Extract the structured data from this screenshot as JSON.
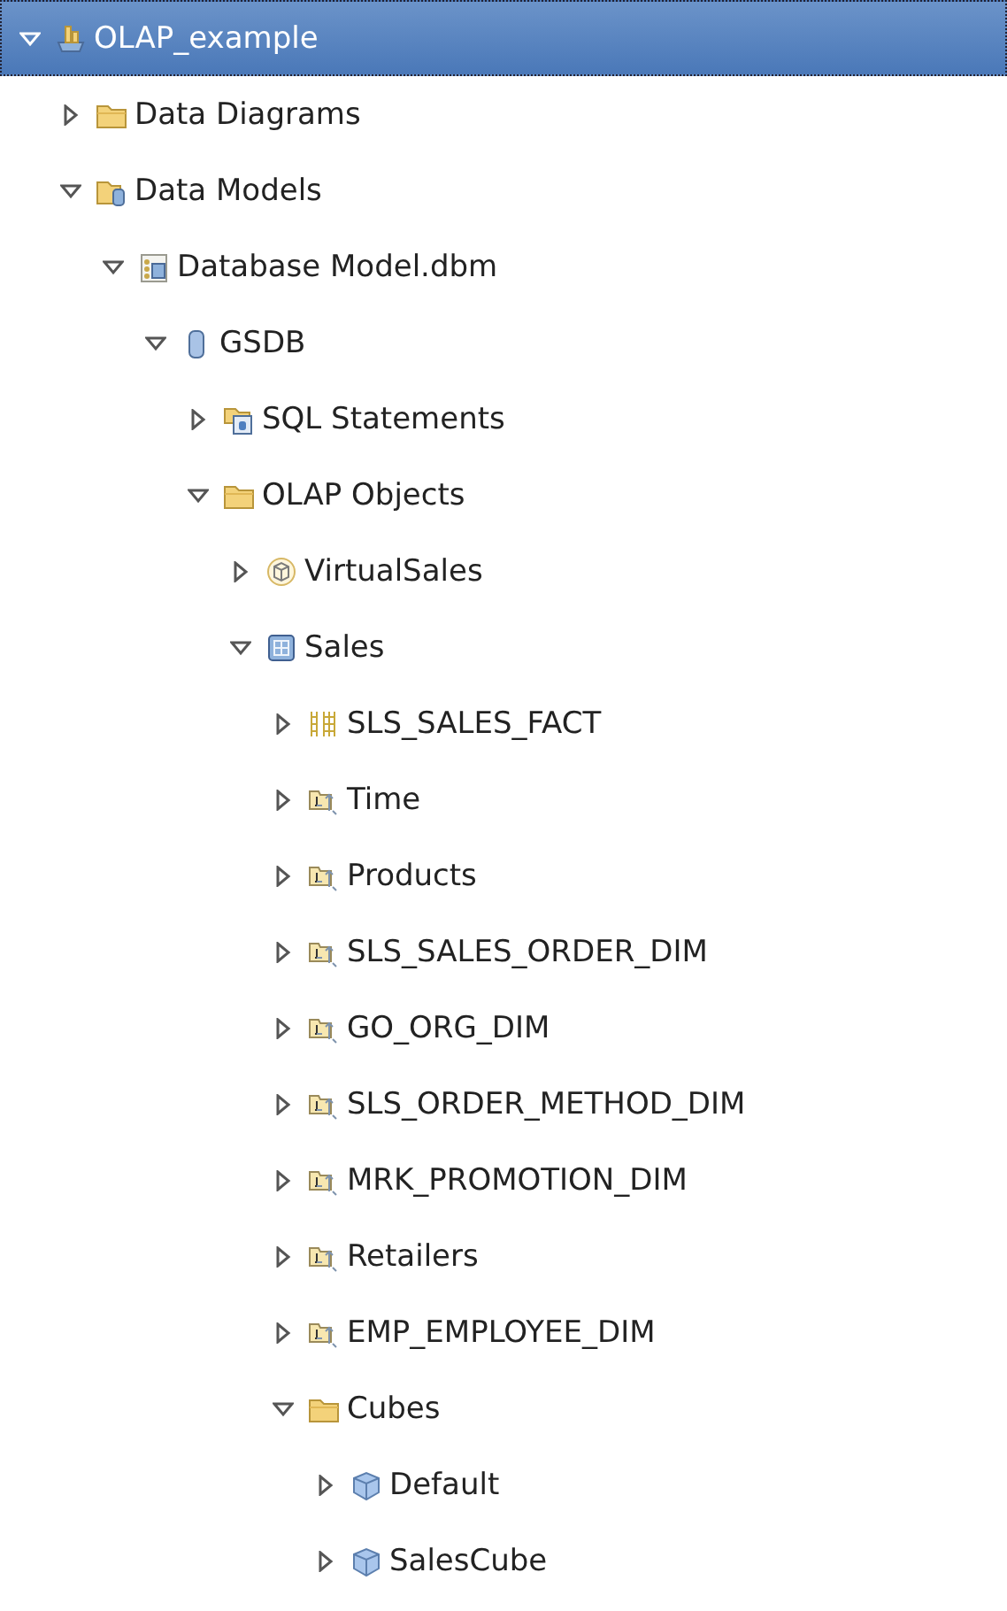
{
  "tree": [
    {
      "label": "OLAP_example",
      "kind": "project",
      "expanded": true,
      "selected": true,
      "children": [
        {
          "label": "Data Diagrams",
          "kind": "folder",
          "expanded": false,
          "selected": false
        },
        {
          "label": "Data Models",
          "kind": "model-folder",
          "expanded": true,
          "selected": false,
          "children": [
            {
              "label": "Database Model.dbm",
              "kind": "dbm",
              "expanded": true,
              "selected": false,
              "children": [
                {
                  "label": "GSDB",
                  "kind": "database",
                  "expanded": true,
                  "selected": false,
                  "children": [
                    {
                      "label": "SQL Statements",
                      "kind": "sql-folder",
                      "expanded": false,
                      "selected": false
                    },
                    {
                      "label": "OLAP Objects",
                      "kind": "folder",
                      "expanded": true,
                      "selected": false,
                      "children": [
                        {
                          "label": "VirtualSales",
                          "kind": "virtual-cube",
                          "expanded": false,
                          "selected": false
                        },
                        {
                          "label": "Sales",
                          "kind": "olap-model",
                          "expanded": true,
                          "selected": false,
                          "children": [
                            {
                              "label": "SLS_SALES_FACT",
                              "kind": "fact",
                              "expanded": false,
                              "selected": false
                            },
                            {
                              "label": "Time",
                              "kind": "dimension",
                              "expanded": false,
                              "selected": false
                            },
                            {
                              "label": "Products",
                              "kind": "dimension",
                              "expanded": false,
                              "selected": false
                            },
                            {
                              "label": "SLS_SALES_ORDER_DIM",
                              "kind": "dimension",
                              "expanded": false,
                              "selected": false
                            },
                            {
                              "label": "GO_ORG_DIM",
                              "kind": "dimension",
                              "expanded": false,
                              "selected": false
                            },
                            {
                              "label": "SLS_ORDER_METHOD_DIM",
                              "kind": "dimension",
                              "expanded": false,
                              "selected": false
                            },
                            {
                              "label": "MRK_PROMOTION_DIM",
                              "kind": "dimension",
                              "expanded": false,
                              "selected": false
                            },
                            {
                              "label": "Retailers",
                              "kind": "dimension",
                              "expanded": false,
                              "selected": false
                            },
                            {
                              "label": "EMP_EMPLOYEE_DIM",
                              "kind": "dimension",
                              "expanded": false,
                              "selected": false
                            },
                            {
                              "label": "Cubes",
                              "kind": "folder",
                              "expanded": true,
                              "selected": false,
                              "children": [
                                {
                                  "label": "Default",
                                  "kind": "cube",
                                  "expanded": false,
                                  "selected": false
                                },
                                {
                                  "label": "SalesCube",
                                  "kind": "cube",
                                  "expanded": false,
                                  "selected": false
                                }
                              ]
                            }
                          ]
                        }
                      ]
                    }
                  ]
                }
              ]
            }
          ]
        }
      ]
    }
  ]
}
